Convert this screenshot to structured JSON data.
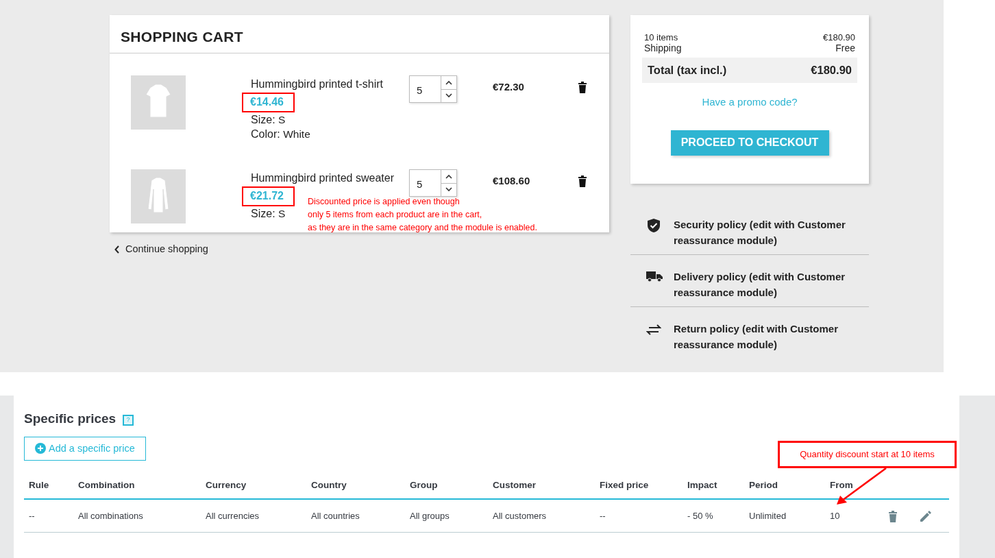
{
  "cart": {
    "title": "SHOPPING CART",
    "items": [
      {
        "kind": "tshirt",
        "name": "Hummingbird printed t-shirt",
        "price": "€14.46",
        "highlighted": true,
        "attributes": [
          {
            "label": "Size:",
            "value": "S"
          },
          {
            "label": "Color:",
            "value": "White"
          }
        ],
        "quantity": "5",
        "total": "€72.30"
      },
      {
        "kind": "sweater",
        "name": "Hummingbird printed sweater",
        "price": "€21.72",
        "highlighted": true,
        "attributes": [
          {
            "label": "Size:",
            "value": "S"
          }
        ],
        "quantity": "5",
        "total": "€108.60"
      }
    ],
    "note": [
      "Discounted price is applied even though",
      "only 5 items from each product are in the cart,",
      "as they are in the same category and the module is enabled."
    ]
  },
  "continue_link": "Continue shopping",
  "summary": {
    "lines": [
      {
        "label": "10 items",
        "value": "€180.90"
      },
      {
        "label": "Shipping",
        "value": "Free"
      }
    ],
    "total": {
      "label": "Total (tax incl.)",
      "value": "€180.90"
    },
    "promo_link": "Have a promo code?",
    "checkout_button": "PROCEED TO CHECKOUT"
  },
  "policies": [
    {
      "kind": "security",
      "text": "Security policy (edit with Customer reassurance module)"
    },
    {
      "kind": "delivery",
      "text": "Delivery policy (edit with Customer reassurance module)"
    },
    {
      "kind": "return",
      "text": "Return policy (edit with Customer reassurance module)"
    }
  ],
  "specific_prices": {
    "title": "Specific prices",
    "help_icon": "?",
    "add_button": "Add a specific price",
    "columns": [
      "Rule",
      "Combination",
      "Currency",
      "Country",
      "Group",
      "Customer",
      "Fixed price",
      "Impact",
      "Period",
      "From"
    ],
    "rows": [
      {
        "cells": [
          "--",
          "All combinations",
          "All currencies",
          "All countries",
          "All groups",
          "All customers",
          "--",
          "- 50 %",
          "Unlimited",
          "10"
        ]
      }
    ],
    "callout": "Quantity discount start at 10 items"
  }
}
